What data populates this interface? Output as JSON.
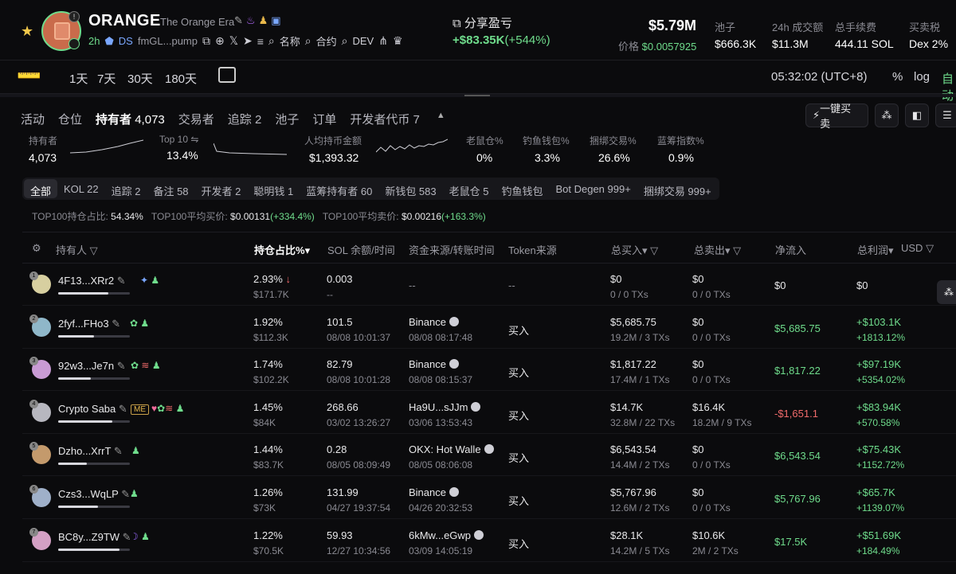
{
  "header": {
    "token_name": "ORANGE",
    "token_fullname": "The Orange Era",
    "age": "2h",
    "ds_label": "DS",
    "address": "fmGL...pump",
    "links": [
      "名称",
      "合约",
      "DEV"
    ],
    "share_label": "分享盈亏",
    "share_value": "+$83.35K",
    "share_pct": "(+544%)",
    "market_cap": "$5.79M",
    "price_label": "价格",
    "price_value": "$0.0057925",
    "stats": [
      {
        "label": "池子",
        "value": "$666.3K"
      },
      {
        "label": "24h 成交额",
        "value": "$11.3M"
      },
      {
        "label": "总手续费",
        "value": "444.11 SOL"
      },
      {
        "label": "买卖税",
        "value": "Dex 2%"
      }
    ]
  },
  "toolbar": {
    "timeframes": [
      "1天",
      "7天",
      "30天",
      "180天"
    ],
    "clock": "05:32:02 (UTC+8)",
    "pct": "%",
    "log": "log",
    "auto": "自动"
  },
  "tabs": [
    {
      "label": "活动",
      "count": ""
    },
    {
      "label": "仓位",
      "count": ""
    },
    {
      "label": "持有者",
      "count": "4,073"
    },
    {
      "label": "交易者",
      "count": ""
    },
    {
      "label": "追踪",
      "count": "2"
    },
    {
      "label": "池子",
      "count": ""
    },
    {
      "label": "订单",
      "count": ""
    },
    {
      "label": "开发者代币",
      "count": "7"
    }
  ],
  "quick_trade_label": "一键买卖",
  "summary": [
    {
      "label": "持有者",
      "value": "4,073"
    },
    {
      "label": "Top 10 ⇋",
      "value": "13.4%"
    },
    {
      "label": "人均持币金额",
      "value": "$1,393.32"
    },
    {
      "label": "老鼠仓%",
      "value": "0%"
    },
    {
      "label": "钓鱼钱包%",
      "value": "3.3%"
    },
    {
      "label": "捆绑交易%",
      "value": "26.6%"
    },
    {
      "label": "蓝筹指数%",
      "value": "0.9%"
    }
  ],
  "chips": [
    "全部",
    "KOL 22",
    "追踪 2",
    "备注 58",
    "开发者 2",
    "聪明钱 1",
    "蓝筹持有者 60",
    "新钱包 583",
    "老鼠仓 5",
    "钓鱼钱包",
    "Bot Degen 999+",
    "捆绑交易 999+"
  ],
  "top100": {
    "share_label": "TOP100持仓占比:",
    "share_value": "54.34%",
    "avg_buy_label": "TOP100平均买价:",
    "avg_buy_value": "$0.00131",
    "avg_buy_pct": "(+334.4%)",
    "avg_sell_label": "TOP100平均卖价:",
    "avg_sell_value": "$0.00216",
    "avg_sell_pct": "(+163.3%)"
  },
  "columns": [
    "持有人",
    "持仓占比%",
    "SOL 余额/时间",
    "资金来源/转账时间",
    "Token来源",
    "总买入",
    "总卖出",
    "净流入",
    "总利润",
    "USD"
  ],
  "rows": [
    {
      "rank": "1",
      "name": "4F13...XRr2",
      "bar": 0.7,
      "pct": "2.93%",
      "pct_usd": "$171.7K",
      "sol": "0.003",
      "sol_time": "--",
      "src": "--",
      "src_time": "",
      "token_src": "--",
      "buy": "$0",
      "buy_tx": "0 / 0 TXs",
      "sell": "$0",
      "sell_tx": "0 / 0 TXs",
      "net": "$0",
      "profit": "$0",
      "profit_pct": ""
    },
    {
      "rank": "2",
      "name": "2fyf...FHo3",
      "bar": 0.5,
      "pct": "1.92%",
      "pct_usd": "$112.3K",
      "sol": "101.5",
      "sol_time": "08/08 10:01:37",
      "src": "Binance",
      "src_time": "08/08 08:17:48",
      "token_src": "买入",
      "buy": "$5,685.75",
      "buy_tx": "19.2M / 3 TXs",
      "sell": "$0",
      "sell_tx": "0 / 0 TXs",
      "net": "$5,685.75",
      "profit": "+$103.1K",
      "profit_pct": "+1813.12%"
    },
    {
      "rank": "3",
      "name": "92w3...Je7n",
      "bar": 0.45,
      "pct": "1.74%",
      "pct_usd": "$102.2K",
      "sol": "82.79",
      "sol_time": "08/08 10:01:28",
      "src": "Binance",
      "src_time": "08/08 08:15:37",
      "token_src": "买入",
      "buy": "$1,817.22",
      "buy_tx": "17.4M / 1 TXs",
      "sell": "$0",
      "sell_tx": "0 / 0 TXs",
      "net": "$1,817.22",
      "profit": "+$97.19K",
      "profit_pct": "+5354.02%"
    },
    {
      "rank": "4",
      "name": "Crypto Saba",
      "bar": 0.75,
      "pct": "1.45%",
      "pct_usd": "$84K",
      "sol": "268.66",
      "sol_time": "03/02 13:26:27",
      "src": "Ha9U...sJJm",
      "src_time": "03/06 13:53:43",
      "token_src": "买入",
      "buy": "$14.7K",
      "buy_tx": "32.8M / 22 TXs",
      "sell": "$16.4K",
      "sell_tx": "18.2M / 9 TXs",
      "net": "-$1,651.1",
      "profit": "+$83.94K",
      "profit_pct": "+570.58%"
    },
    {
      "rank": "5",
      "name": "Dzho...XrrT",
      "bar": 0.4,
      "pct": "1.44%",
      "pct_usd": "$83.7K",
      "sol": "0.28",
      "sol_time": "08/05 08:09:49",
      "src": "OKX: Hot Walle",
      "src_time": "08/05 08:06:08",
      "token_src": "买入",
      "buy": "$6,543.54",
      "buy_tx": "14.4M / 2 TXs",
      "sell": "$0",
      "sell_tx": "0 / 0 TXs",
      "net": "$6,543.54",
      "profit": "+$75.43K",
      "profit_pct": "+1152.72%"
    },
    {
      "rank": "6",
      "name": "Czs3...WqLP",
      "bar": 0.55,
      "pct": "1.26%",
      "pct_usd": "$73K",
      "sol": "131.99",
      "sol_time": "04/27 19:37:54",
      "src": "Binance",
      "src_time": "04/26 20:32:53",
      "token_src": "买入",
      "buy": "$5,767.96",
      "buy_tx": "12.6M / 2 TXs",
      "sell": "$0",
      "sell_tx": "0 / 0 TXs",
      "net": "$5,767.96",
      "profit": "+$65.7K",
      "profit_pct": "+1139.07%"
    },
    {
      "rank": "7",
      "name": "BC8y...Z9TW",
      "bar": 0.85,
      "pct": "1.22%",
      "pct_usd": "$70.5K",
      "sol": "59.93",
      "sol_time": "12/27 10:34:56",
      "src": "6kMw...eGwp",
      "src_time": "03/09 14:05:19",
      "token_src": "买入",
      "buy": "$28.1K",
      "buy_tx": "14.2M / 5 TXs",
      "sell": "$10.6K",
      "sell_tx": "2M / 2 TXs",
      "net": "$17.5K",
      "profit": "+$51.69K",
      "profit_pct": "+184.49%"
    }
  ],
  "colors": {
    "green": "#6fdc8c",
    "red": "#f06b6b",
    "bg": "#0b0b0d"
  }
}
